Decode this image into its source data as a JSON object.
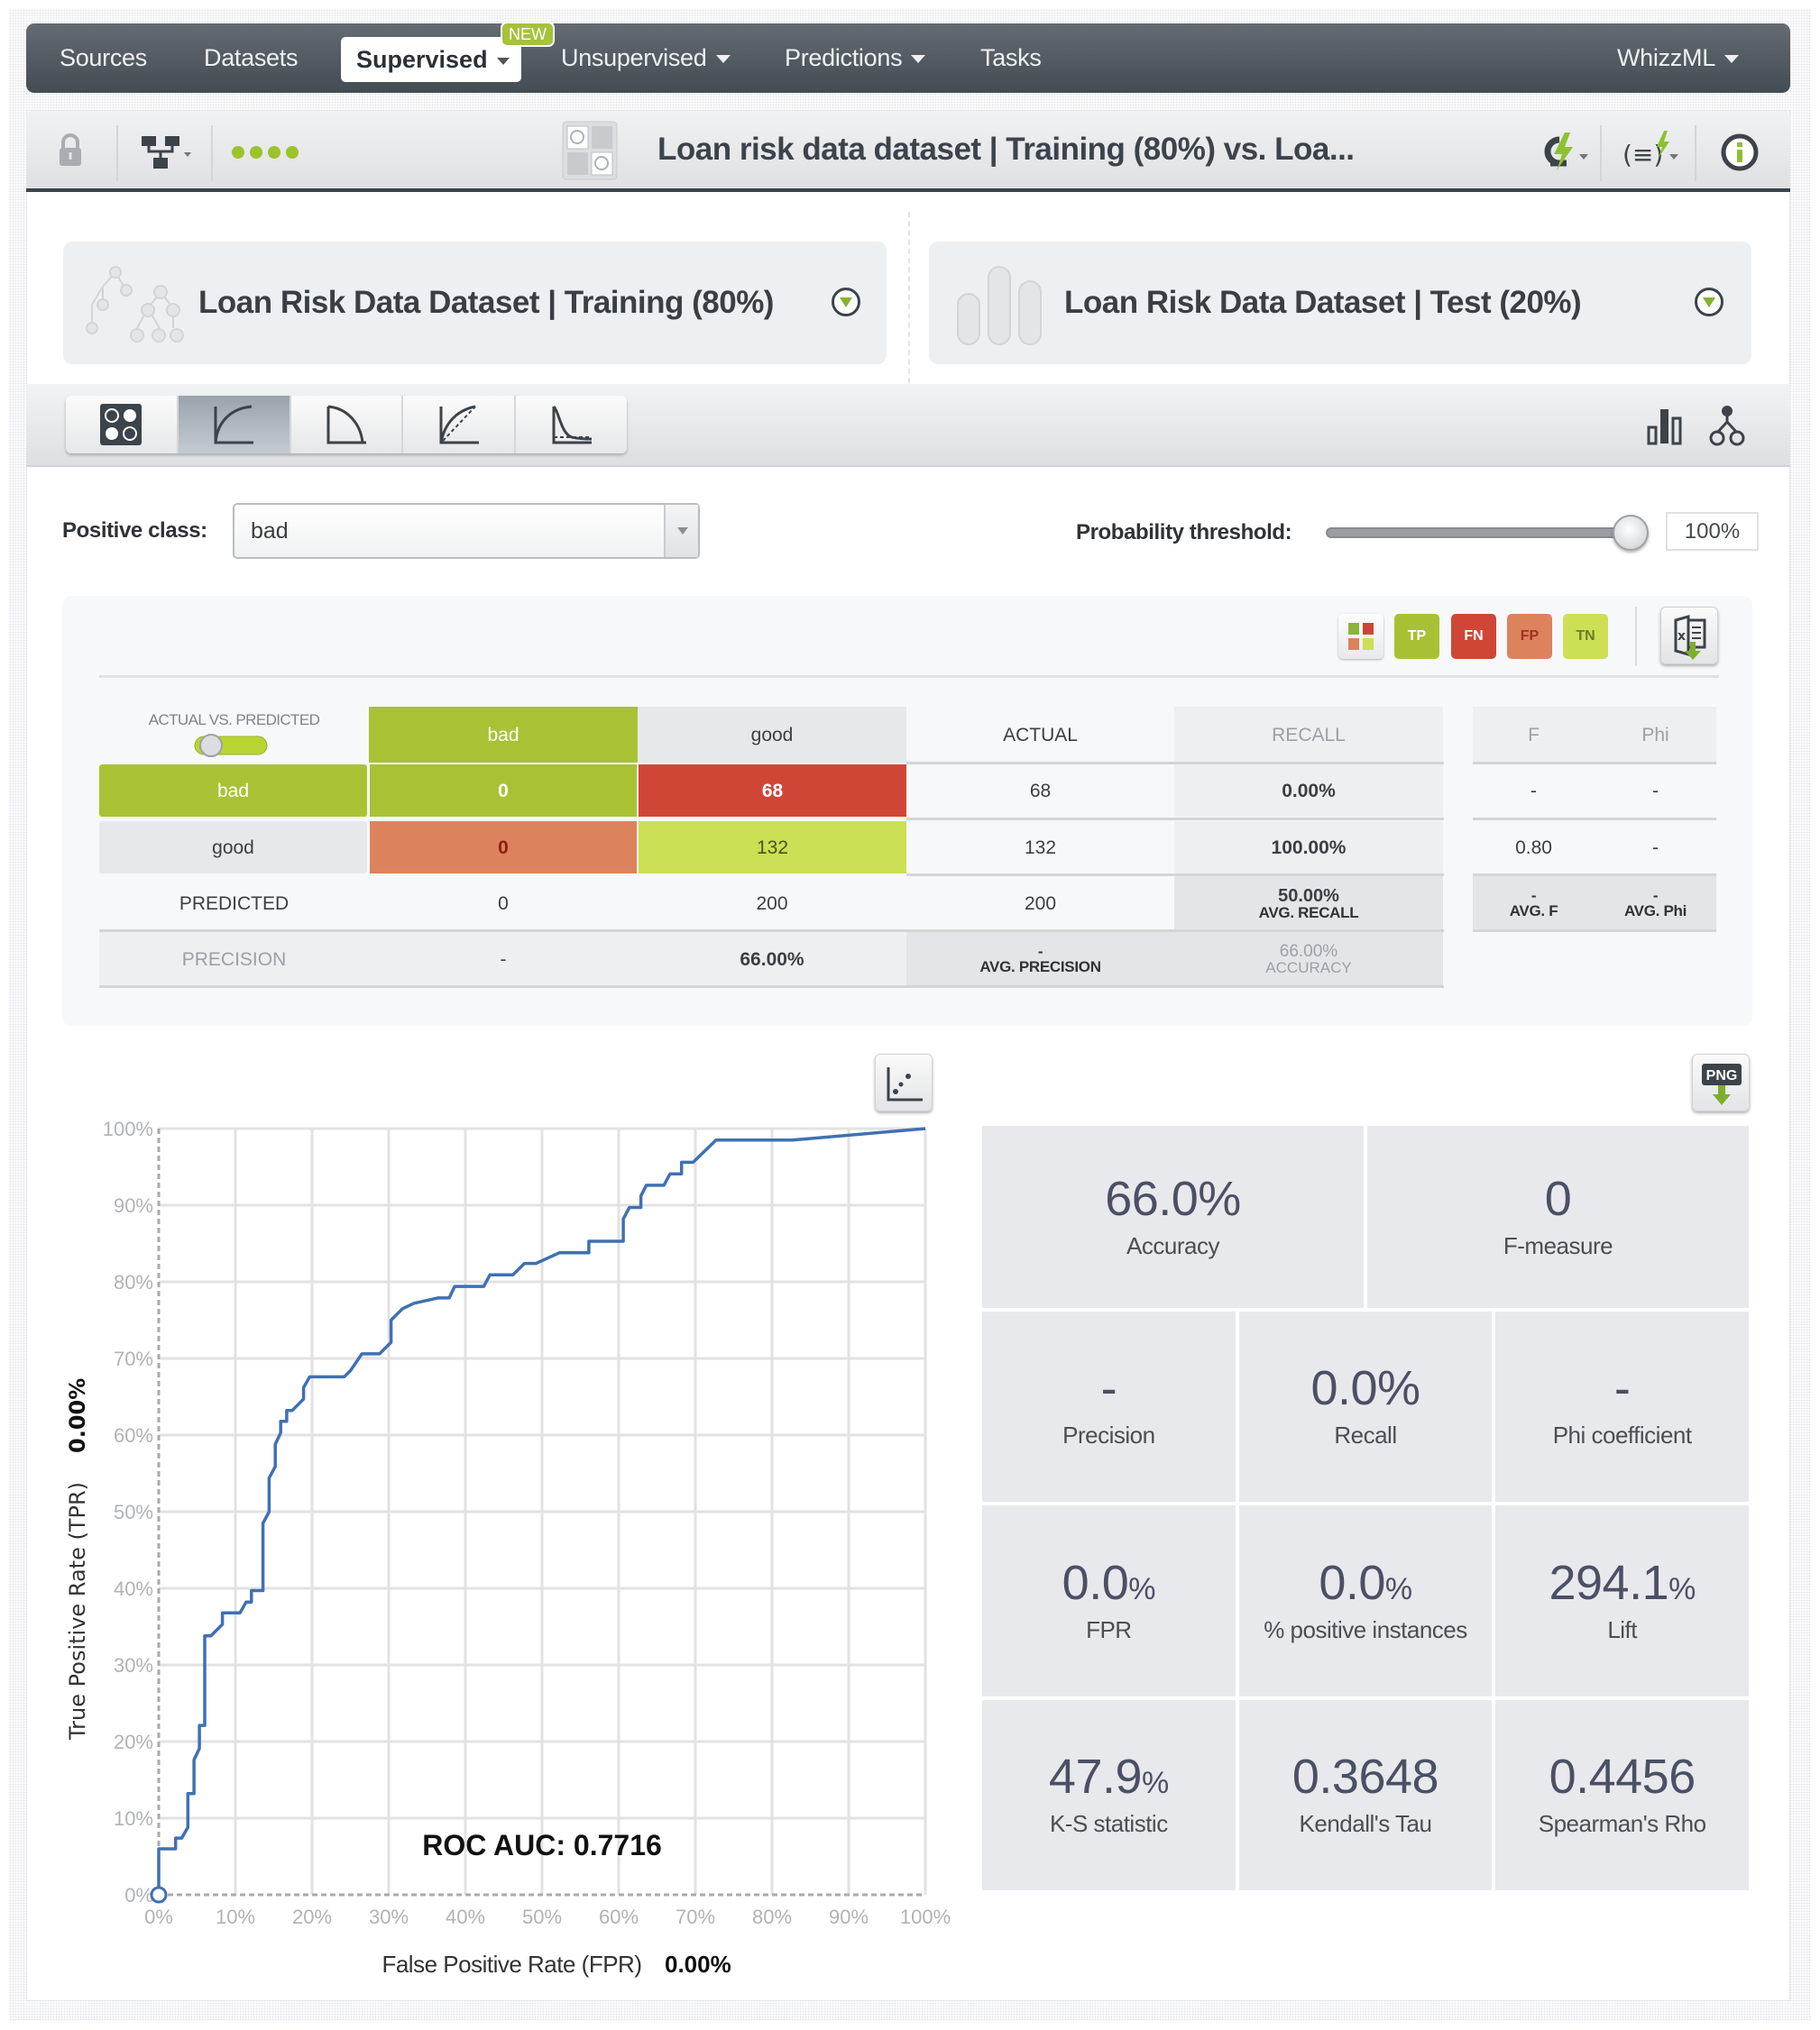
{
  "navbar": {
    "items": [
      {
        "label": "Sources"
      },
      {
        "label": "Datasets"
      },
      {
        "label": "Supervised",
        "active": true,
        "badge": "NEW",
        "dropdown": true
      },
      {
        "label": "Unsupervised",
        "dropdown": true
      },
      {
        "label": "Predictions",
        "dropdown": true
      },
      {
        "label": "Tasks"
      }
    ],
    "right_menu": "WhizzML"
  },
  "header": {
    "title": "Loan risk data dataset | Training (80%) vs. Loa...",
    "icons": [
      "lock-icon",
      "network-icon",
      "status-dots-icon",
      "evaluation-icon",
      "cloud-action-icon",
      "whizzml-script-icon",
      "info-icon"
    ],
    "status_dots_color": "#9dc32a"
  },
  "cards": {
    "left": {
      "title": "Loan Risk Data Dataset | Training (80%)",
      "icon": "ensemble-tree-icon"
    },
    "right": {
      "title": "Loan Risk Data Dataset | Test (20%)",
      "icon": "dataset-bars-icon"
    }
  },
  "toolbar": {
    "views": [
      {
        "name": "confusion-matrix",
        "icon": "confusion-matrix-icon",
        "active": false
      },
      {
        "name": "roc-curve",
        "icon": "roc-curve-icon",
        "active": true
      },
      {
        "name": "precision-recall-curve",
        "icon": "precision-recall-icon",
        "active": false
      },
      {
        "name": "gain-curve",
        "icon": "gain-curve-icon",
        "active": false
      },
      {
        "name": "lift-curve",
        "icon": "lift-curve-icon",
        "active": false
      }
    ],
    "right_icons": [
      "bar-chart-icon",
      "model-tree-icon"
    ]
  },
  "controls": {
    "positive_class_label": "Positive class:",
    "positive_class_value": "bad",
    "threshold_label": "Probability threshold:",
    "threshold_value": "100%",
    "threshold_fraction": 1.0
  },
  "legend": {
    "buttons": [
      {
        "label": "TP",
        "color": "#a8c134"
      },
      {
        "label": "FN",
        "color": "#cf4637"
      },
      {
        "label": "FP",
        "color": "#dc825c"
      },
      {
        "label": "TN",
        "color": "#cddf55"
      }
    ]
  },
  "matrix": {
    "toggle_label": "ACTUAL VS. PREDICTED",
    "classes": [
      "bad",
      "good"
    ],
    "col_headers": {
      "actual": "ACTUAL",
      "recall": "RECALL",
      "f": "F",
      "phi": "Phi"
    },
    "rows": [
      {
        "label": "bad",
        "cells": [
          "0",
          "68"
        ],
        "actual": "68",
        "recall": "0.00%",
        "f": "-",
        "phi": "-"
      },
      {
        "label": "good",
        "cells": [
          "0",
          "132"
        ],
        "actual": "132",
        "recall": "100.00%",
        "f": "0.80",
        "phi": "-"
      }
    ],
    "predicted": {
      "label": "PREDICTED",
      "values": [
        "0",
        "200"
      ],
      "total": "200",
      "avg_recall_value": "50.00%",
      "avg_recall_label": "AVG. RECALL",
      "avg_f_value": "-",
      "avg_f_label": "AVG. F",
      "avg_phi_value": "-",
      "avg_phi_label": "AVG. Phi"
    },
    "precision": {
      "label": "PRECISION",
      "values": [
        "-",
        "66.00%"
      ],
      "avg_precision_value": "-",
      "avg_precision_label": "AVG. PRECISION",
      "accuracy_value": "66.00%",
      "accuracy_label": "ACCURACY"
    }
  },
  "metrics": {
    "row1": [
      {
        "value": "66.0%",
        "unit": "",
        "label": "Accuracy"
      },
      {
        "value": "0",
        "unit": "",
        "label": "F-measure"
      }
    ],
    "row2": [
      {
        "value": "-",
        "unit": "",
        "label": "Precision"
      },
      {
        "value": "0.0%",
        "unit": "",
        "label": "Recall"
      },
      {
        "value": "-",
        "unit": "",
        "label": "Phi coefficient"
      }
    ],
    "row3": [
      {
        "value": "0.0",
        "unit": "%",
        "label": "FPR"
      },
      {
        "value": "0.0",
        "unit": "%",
        "label": "% positive instances"
      },
      {
        "value": "294.1",
        "unit": "%",
        "label": "Lift"
      }
    ],
    "row4": [
      {
        "value": "47.9",
        "unit": "%",
        "label": "K-S statistic"
      },
      {
        "value": "0.3648",
        "unit": "",
        "label": "Kendall's Tau"
      },
      {
        "value": "0.4456",
        "unit": "",
        "label": "Spearman's Rho"
      }
    ]
  },
  "chart_data": {
    "type": "line",
    "title": "",
    "annotation": "ROC AUC: 0.7716",
    "xlabel": "False Positive Rate (FPR)",
    "xlabel_value": "0.00%",
    "ylabel": "True Positive Rate (TPR)",
    "ylabel_value": "0.00%",
    "xlim": [
      0,
      100
    ],
    "ylim": [
      0,
      100
    ],
    "x_ticks": [
      "0%",
      "10%",
      "20%",
      "30%",
      "40%",
      "50%",
      "60%",
      "70%",
      "80%",
      "90%",
      "100%"
    ],
    "y_ticks": [
      "0%",
      "10%",
      "20%",
      "30%",
      "40%",
      "50%",
      "60%",
      "70%",
      "80%",
      "90%",
      "100%"
    ],
    "grid": true,
    "line_color": "#3f70b3",
    "marker": {
      "x": 0,
      "y": 0
    },
    "series": [
      {
        "name": "ROC",
        "points": [
          [
            0,
            0
          ],
          [
            0,
            6
          ],
          [
            2.2,
            6
          ],
          [
            2.2,
            7.4
          ],
          [
            3,
            7.4
          ],
          [
            3.8,
            8.8
          ],
          [
            3.8,
            13.2
          ],
          [
            4.6,
            13.2
          ],
          [
            4.6,
            17.6
          ],
          [
            5.3,
            19.1
          ],
          [
            5.3,
            22.1
          ],
          [
            6,
            22.1
          ],
          [
            6,
            33.8
          ],
          [
            6.8,
            33.8
          ],
          [
            8.3,
            35.3
          ],
          [
            8.3,
            36.8
          ],
          [
            10.6,
            36.8
          ],
          [
            11.4,
            38.2
          ],
          [
            12.1,
            38.2
          ],
          [
            12.1,
            39.7
          ],
          [
            13.6,
            39.7
          ],
          [
            13.6,
            48.5
          ],
          [
            14.4,
            50
          ],
          [
            14.4,
            54.4
          ],
          [
            15.2,
            55.9
          ],
          [
            15.2,
            58.8
          ],
          [
            15.9,
            60.3
          ],
          [
            15.9,
            61.8
          ],
          [
            16.7,
            61.8
          ],
          [
            16.7,
            63.2
          ],
          [
            17.4,
            63.2
          ],
          [
            18.9,
            64.7
          ],
          [
            18.9,
            66.2
          ],
          [
            19.7,
            67.6
          ],
          [
            24.2,
            67.6
          ],
          [
            25,
            68.4
          ],
          [
            26.5,
            70.6
          ],
          [
            28.8,
            70.6
          ],
          [
            30.3,
            72.1
          ],
          [
            30.3,
            75
          ],
          [
            31.8,
            76.5
          ],
          [
            33.3,
            77.2
          ],
          [
            36.4,
            77.9
          ],
          [
            37.9,
            77.9
          ],
          [
            38.6,
            79.4
          ],
          [
            42.4,
            79.4
          ],
          [
            43.2,
            80.9
          ],
          [
            46.2,
            80.9
          ],
          [
            47.7,
            82.4
          ],
          [
            49.2,
            82.4
          ],
          [
            52.3,
            83.8
          ],
          [
            56.1,
            83.8
          ],
          [
            56.1,
            85.3
          ],
          [
            60.6,
            85.3
          ],
          [
            60.6,
            88.2
          ],
          [
            61.4,
            89.7
          ],
          [
            62.9,
            89.7
          ],
          [
            62.9,
            91.2
          ],
          [
            63.6,
            92.6
          ],
          [
            65.9,
            92.6
          ],
          [
            66.7,
            94.1
          ],
          [
            68.2,
            94.1
          ],
          [
            68.2,
            95.6
          ],
          [
            69.7,
            95.6
          ],
          [
            72.7,
            98.5
          ],
          [
            82.6,
            98.5
          ],
          [
            100,
            100
          ]
        ]
      }
    ]
  }
}
